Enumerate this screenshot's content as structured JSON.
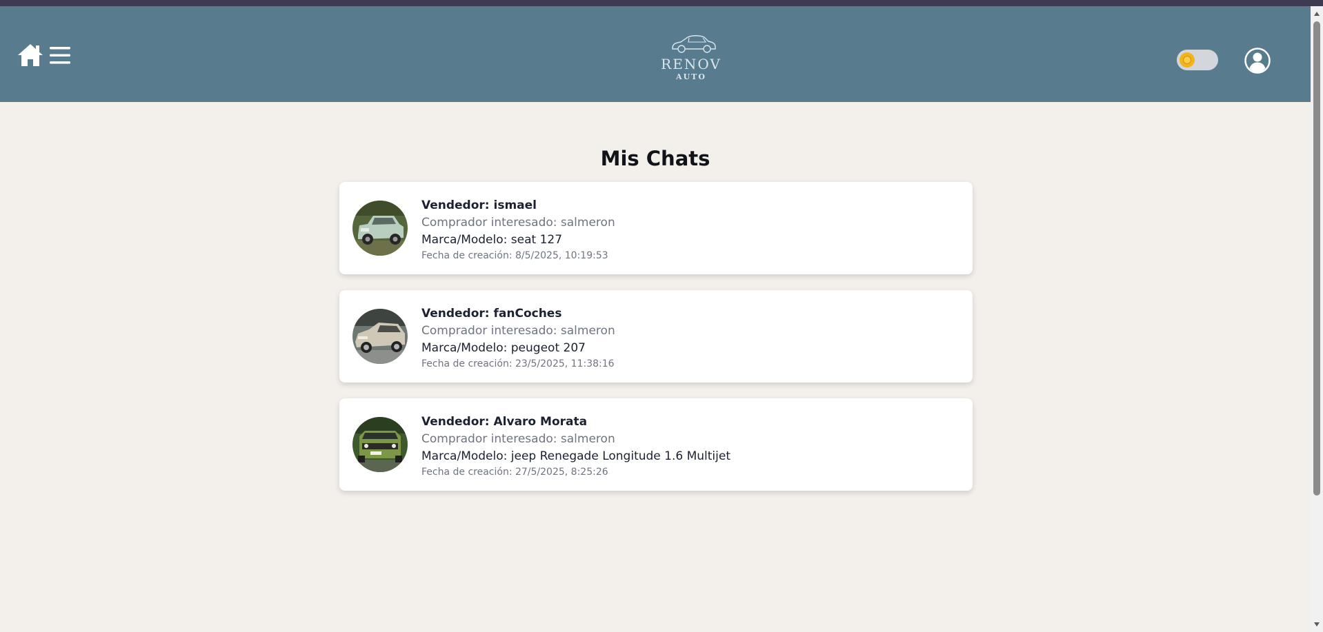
{
  "header": {
    "logo_brand": "RENOV",
    "logo_sub": "AUTO",
    "home_icon": "home-icon",
    "menu_icon": "hamburger-menu-icon",
    "profile_icon": "user-profile-icon",
    "theme_toggle_icon": "sun-icon",
    "theme_toggle_state": "light",
    "colors": {
      "navbar_bg": "#587c8e",
      "page_bg": "#f3efeb",
      "toggle_knob": "#f1b51b"
    }
  },
  "main": {
    "title": "Mis Chats",
    "chats": [
      {
        "seller": "Vendedor: ismael",
        "buyer": "Comprador interesado: salmeron",
        "model": "Marca/Modelo: seat 127",
        "created": "Fecha de creación: 8/5/2025, 10:19:53",
        "thumb_icon": "car-photo-seat-127"
      },
      {
        "seller": "Vendedor: fanCoches",
        "buyer": "Comprador interesado: salmeron",
        "model": "Marca/Modelo: peugeot 207",
        "created": "Fecha de creación: 23/5/2025, 11:38:16",
        "thumb_icon": "car-photo-peugeot-207"
      },
      {
        "seller": "Vendedor: Alvaro Morata",
        "buyer": "Comprador interesado: salmeron",
        "model": "Marca/Modelo: jeep Renegade Longitude 1.6 Multijet",
        "created": "Fecha de creación: 27/5/2025, 8:25:26",
        "thumb_icon": "car-photo-jeep-renegade"
      }
    ]
  }
}
